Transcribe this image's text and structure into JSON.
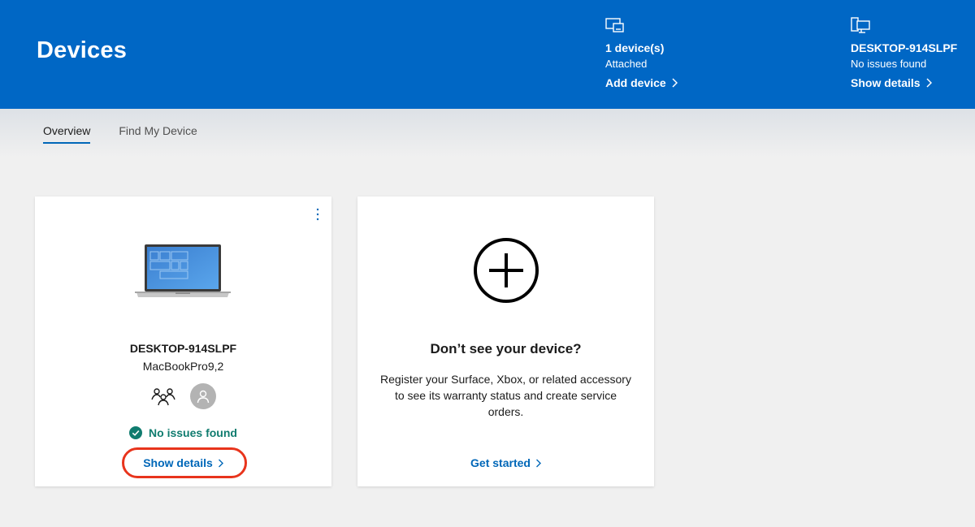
{
  "header": {
    "title": "Devices",
    "attached": {
      "icon": "devices-icon",
      "count_text": "1 device(s)",
      "sub_text": "Attached",
      "link_label": "Add device"
    },
    "current_device": {
      "icon": "desktop-icon",
      "name": "DESKTOP-914SLPF",
      "status": "No issues found",
      "link_label": "Show details"
    }
  },
  "tabs": [
    {
      "label": "Overview",
      "active": true
    },
    {
      "label": "Find My Device",
      "active": false
    }
  ],
  "device_card": {
    "menu_icon": "more-vertical-icon",
    "image": "laptop-icon",
    "name": "DESKTOP-914SLPF",
    "model": "MacBookPro9,2",
    "family_icon": "family-icon",
    "avatar_icon": "user-avatar-icon",
    "status": "No issues found",
    "link_label": "Show details"
  },
  "add_card": {
    "icon": "plus-circle-icon",
    "title": "Don’t see your device?",
    "description": "Register your Surface, Xbox, or related accessory to see its warranty status and create service orders.",
    "link_label": "Get started"
  },
  "colors": {
    "header_bg": "#0067c5",
    "link": "#0067b8",
    "status_ok": "#107c6f",
    "highlight": "#e8341c"
  }
}
